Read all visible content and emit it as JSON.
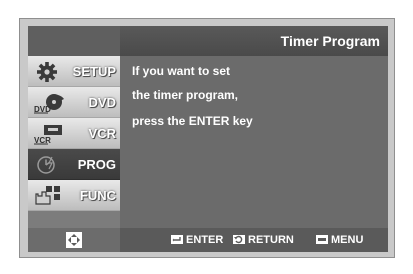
{
  "header": {
    "title": "Timer Program"
  },
  "menu": {
    "items": [
      {
        "label": "SETUP",
        "icon": "gear-icon",
        "active": false
      },
      {
        "label": "DVD",
        "icon": "dvd-icon",
        "active": false
      },
      {
        "label": "VCR",
        "icon": "vcr-icon",
        "active": false
      },
      {
        "label": "PROG",
        "icon": "timer-clock-icon",
        "active": true
      },
      {
        "label": "FUNC",
        "icon": "function-icon",
        "active": false
      }
    ],
    "dvd_logo_text": "DVD",
    "vcr_logo_text": "VCR"
  },
  "content": {
    "lines": [
      "If you want to set",
      "the timer program,",
      "press the ENTER key"
    ]
  },
  "footer": {
    "enter_label": "ENTER",
    "return_label": "RETURN",
    "menu_label": "MENU"
  },
  "colors": {
    "panel": "#636363",
    "header": "#4a4a4a",
    "active_item": "#3a3a3a",
    "inactive_item": "#d3d3d3"
  }
}
